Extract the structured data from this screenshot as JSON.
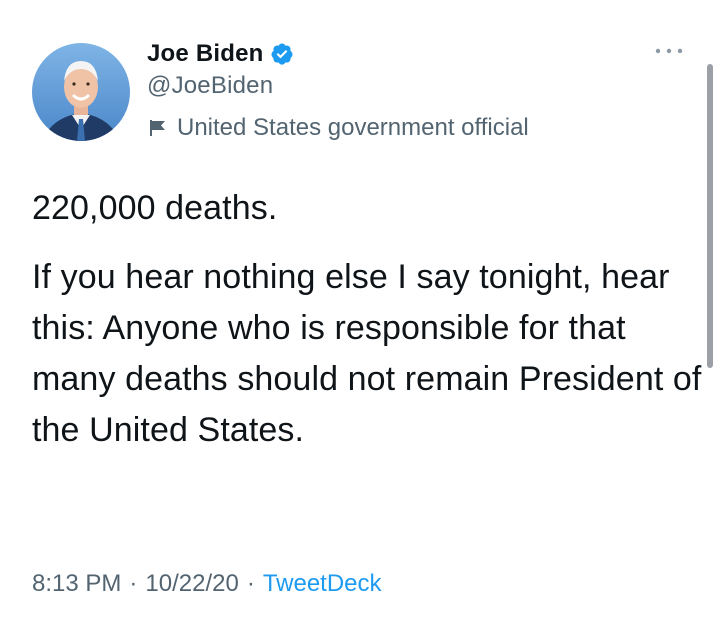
{
  "author": {
    "display_name": "Joe Biden",
    "handle": "@JoeBiden",
    "label": "United States government official",
    "verified": true
  },
  "tweet": {
    "text_line1": "220,000 deaths.",
    "text_paragraph2": "If you hear nothing else I say tonight, hear this: Anyone who is responsible for that many deaths should not remain President of the United States."
  },
  "meta": {
    "time": "8:13 PM",
    "separator": "·",
    "date": "10/22/20",
    "source": "TweetDeck"
  },
  "icons": {
    "verified": "verified-badge-icon",
    "label": "flag-icon",
    "more": "more-options-icon"
  },
  "colors": {
    "accent": "#1d9bf0",
    "text": "#0f1419",
    "secondary": "#536471"
  }
}
